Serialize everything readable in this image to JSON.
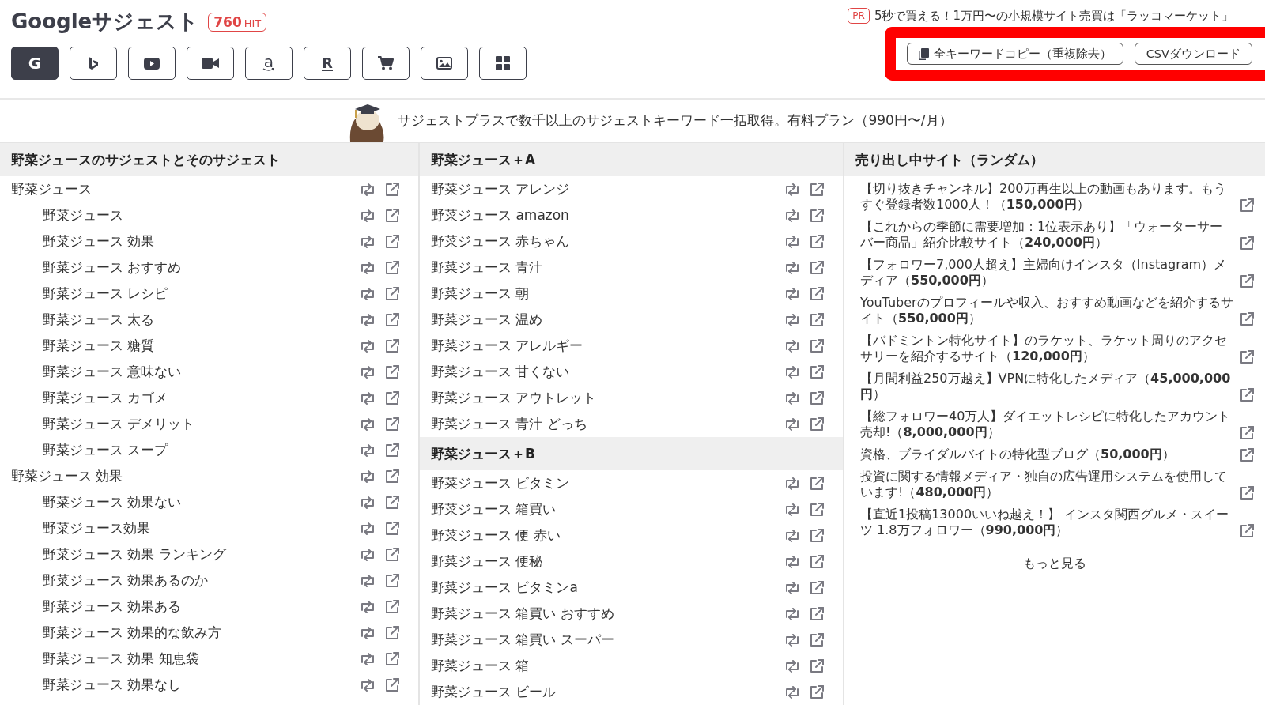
{
  "header": {
    "title": "Googleサジェスト",
    "hit_count": "760",
    "hit_unit": "HIT",
    "engines": [
      {
        "kind": "google",
        "glyph": "G",
        "selected": true
      },
      {
        "kind": "bing",
        "selected": false
      },
      {
        "kind": "youtube",
        "selected": false
      },
      {
        "kind": "video",
        "selected": false
      },
      {
        "kind": "amazon",
        "glyph": "a",
        "selected": false
      },
      {
        "kind": "rakuten",
        "glyph": "R",
        "selected": false
      },
      {
        "kind": "cart",
        "selected": false
      },
      {
        "kind": "image",
        "selected": false
      },
      {
        "kind": "grid",
        "selected": false
      }
    ],
    "ad": {
      "badge": "PR",
      "text": "5秒で買える！1万円〜の小規模サイト売買は「ラッコマーケット」"
    },
    "actions": [
      {
        "kind": "copy",
        "label": "全キーワードコピー（重複除去）"
      },
      {
        "kind": "download",
        "label": "CSVダウンロード"
      }
    ]
  },
  "banner": {
    "text": "サジェストプラスで数千以上のサジェストキーワード一括取得。有料プラン（990円〜/月）"
  },
  "suggest_column": {
    "heading": "野菜ジュースのサジェストとそのサジェスト",
    "items": [
      {
        "keyword": "野菜ジュース",
        "children": [
          {
            "keyword": "野菜ジュース"
          },
          {
            "keyword": "野菜ジュース 効果"
          },
          {
            "keyword": "野菜ジュース おすすめ"
          },
          {
            "keyword": "野菜ジュース レシピ"
          },
          {
            "keyword": "野菜ジュース 太る"
          },
          {
            "keyword": "野菜ジュース 糖質"
          },
          {
            "keyword": "野菜ジュース 意味ない"
          },
          {
            "keyword": "野菜ジュース カゴメ"
          },
          {
            "keyword": "野菜ジュース デメリット"
          },
          {
            "keyword": "野菜ジュース スープ"
          }
        ]
      },
      {
        "keyword": "野菜ジュース 効果",
        "children": [
          {
            "keyword": "野菜ジュース 効果ない"
          },
          {
            "keyword": "野菜ジュース効果"
          },
          {
            "keyword": "野菜ジュース 効果 ランキング"
          },
          {
            "keyword": "野菜ジュース 効果あるのか"
          },
          {
            "keyword": "野菜ジュース 効果ある"
          },
          {
            "keyword": "野菜ジュース 効果的な飲み方"
          },
          {
            "keyword": "野菜ジュース 効果 知恵袋"
          },
          {
            "keyword": "野菜ジュース 効果なし"
          }
        ]
      }
    ]
  },
  "letter_column": {
    "sections": [
      {
        "heading": "野菜ジュース＋A",
        "keywords": [
          "野菜ジュース アレンジ",
          "野菜ジュース amazon",
          "野菜ジュース 赤ちゃん",
          "野菜ジュース 青汁",
          "野菜ジュース 朝",
          "野菜ジュース 温め",
          "野菜ジュース アレルギー",
          "野菜ジュース 甘くない",
          "野菜ジュース アウトレット",
          "野菜ジュース 青汁 どっち"
        ]
      },
      {
        "heading": "野菜ジュース＋B",
        "keywords": [
          "野菜ジュース ビタミン",
          "野菜ジュース 箱買い",
          "野菜ジュース 便 赤い",
          "野菜ジュース 便秘",
          "野菜ジュース ビタミンa",
          "野菜ジュース 箱買い おすすめ",
          "野菜ジュース 箱買い スーパー",
          "野菜ジュース 箱",
          "野菜ジュース ビール"
        ]
      }
    ]
  },
  "sites_column": {
    "heading": "売り出し中サイト（ランダム）",
    "sites": [
      "【切り抜きチャンネル】200万再生以上の動画もあります。もうすぐ登録者数1000人！（**150,000円**）",
      "【これからの季節に需要増加：1位表示あり】「ウォーターサーバー商品」紹介比較サイト（**240,000円**）",
      "【フォロワー7,000人超え】主婦向けインスタ（Instagram）メディア（**550,000円**）",
      "YouTuberのプロフィールや収入、おすすめ動画などを紹介するサイト（**550,000円**）",
      "【バドミントン特化サイト】のラケット、ラケット周りのアクセサリーを紹介するサイト（**120,000円**）",
      "【月間利益250万越え】VPNに特化したメディア（**45,000,000円**）",
      "【総フォロワー40万人】ダイエットレシピに特化したアカウント売却!（**8,000,000円**）",
      "資格、ブライダルバイトの特化型ブログ（**50,000円**）",
      "投資に関する情報メディア・独自の広告運用システムを使用しています!（**480,000円**）",
      "【直近1投稿13000いいね越え！】 インスタ関西グルメ・スイーツ 1.8万フォロワー（**990,000円**）"
    ],
    "more": "もっと見る"
  }
}
